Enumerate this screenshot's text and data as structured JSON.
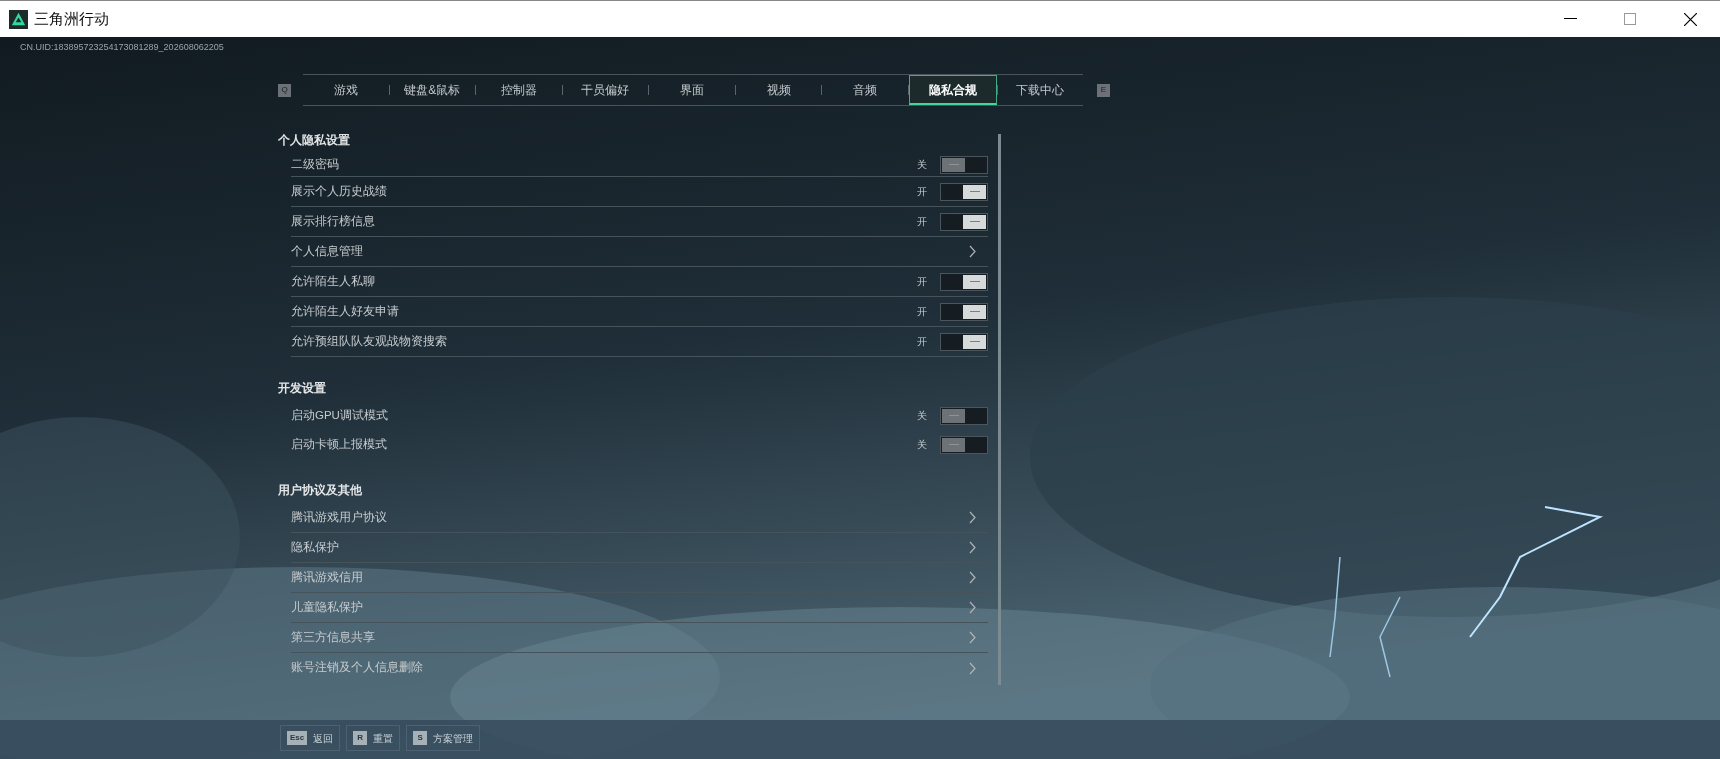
{
  "window": {
    "title": "三角洲行动"
  },
  "uid": "CN.UID:183895723254173081289_202608062205",
  "tab_keys": {
    "prev": "Q",
    "next": "E"
  },
  "tabs": [
    {
      "label": "游戏",
      "selected": false
    },
    {
      "label": "键盘&鼠标",
      "selected": false
    },
    {
      "label": "控制器",
      "selected": false
    },
    {
      "label": "干员偏好",
      "selected": false
    },
    {
      "label": "界面",
      "selected": false
    },
    {
      "label": "视频",
      "selected": false
    },
    {
      "label": "音频",
      "selected": false
    },
    {
      "label": "隐私合规",
      "selected": true
    },
    {
      "label": "下载中心",
      "selected": false
    }
  ],
  "sections": [
    {
      "title": "个人隐私设置",
      "items": [
        {
          "kind": "toggle",
          "label": "二级密码",
          "state_text": "关",
          "on": false
        },
        {
          "kind": "toggle",
          "label": "展示个人历史战绩",
          "state_text": "开",
          "on": true
        },
        {
          "kind": "toggle",
          "label": "展示排行榜信息",
          "state_text": "开",
          "on": true
        },
        {
          "kind": "link",
          "label": "个人信息管理"
        },
        {
          "kind": "toggle",
          "label": "允许陌生人私聊",
          "state_text": "开",
          "on": true
        },
        {
          "kind": "toggle",
          "label": "允许陌生人好友申请",
          "state_text": "开",
          "on": true
        },
        {
          "kind": "toggle",
          "label": "允许预组队队友观战物资搜索",
          "state_text": "开",
          "on": true
        }
      ]
    },
    {
      "title": "开发设置",
      "items": [
        {
          "kind": "toggle",
          "label": "启动GPU调试模式",
          "state_text": "关",
          "on": false
        },
        {
          "kind": "toggle",
          "label": "启动卡顿上报模式",
          "state_text": "关",
          "on": false
        }
      ]
    },
    {
      "title": "用户协议及其他",
      "items": [
        {
          "kind": "link",
          "label": "腾讯游戏用户协议"
        },
        {
          "kind": "link",
          "label": "隐私保护"
        },
        {
          "kind": "link",
          "label": "腾讯游戏信用"
        },
        {
          "kind": "link",
          "label": "儿童隐私保护"
        },
        {
          "kind": "link",
          "label": "第三方信息共享"
        },
        {
          "kind": "link",
          "label": "账号注销及个人信息删除"
        }
      ]
    }
  ],
  "footer": [
    {
      "key": "Esc",
      "label": "返回"
    },
    {
      "key": "R",
      "label": "重置"
    },
    {
      "key": "S",
      "label": "方案管理"
    }
  ]
}
